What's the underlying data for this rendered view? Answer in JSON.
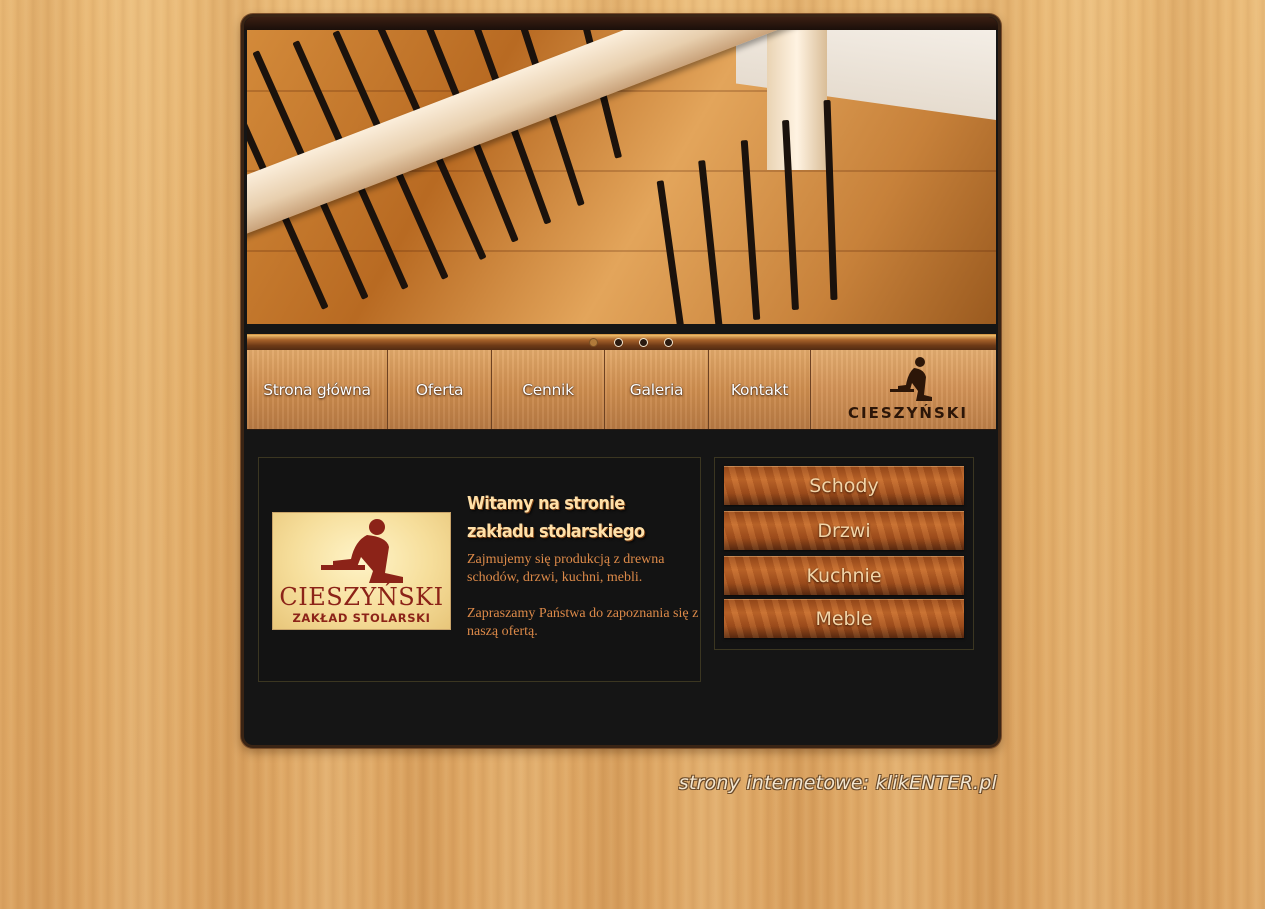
{
  "header": {
    "slider": {
      "slide_count": 4,
      "active_slide": 1
    }
  },
  "nav": {
    "items": [
      {
        "label": "Strona główna"
      },
      {
        "label": "Oferta"
      },
      {
        "label": "Cennik"
      },
      {
        "label": "Galeria"
      },
      {
        "label": "Kontakt"
      }
    ],
    "brand": "CIESZYŃSKI"
  },
  "welcome": {
    "logo_name": "CIESZYŃSKI",
    "logo_subtitle": "ZAKŁAD STOLARSKI",
    "title_line1": "Witamy na stronie",
    "title_line2": "zakładu stolarskiego",
    "paragraph1": "Zajmujemy się produkcją z drewna schodów, drzwi, kuchni, mebli.",
    "paragraph2": "Zapraszamy Państwa do zapoznania się z naszą ofertą."
  },
  "categories": [
    {
      "label": "Schody"
    },
    {
      "label": "Drzwi"
    },
    {
      "label": "Kuchnie"
    },
    {
      "label": "Meble"
    }
  ],
  "footer": {
    "credit": "strony internetowe: klikENTER.pl"
  },
  "colors": {
    "accent_text": "#dd8a49",
    "title_text": "#ffe0a8",
    "logo_red": "#8c2318",
    "panel_bg": "#151515"
  }
}
